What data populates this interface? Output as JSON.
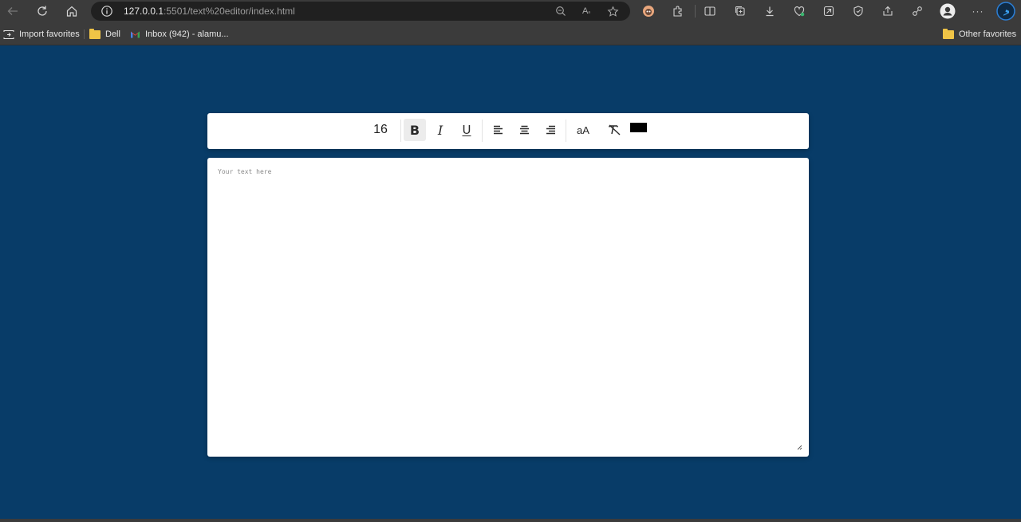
{
  "browser": {
    "url_host": "127.0.0.1",
    "url_rest": ":5501/text%20editor/index.html",
    "favorites": [
      {
        "label": "Import favorites"
      },
      {
        "label": "Dell"
      },
      {
        "label": "Inbox (942) - alamu..."
      }
    ],
    "other_favorites": "Other favorites",
    "more_label": "···"
  },
  "editor": {
    "font_size": "16",
    "bold_label": "B",
    "italic_label": "I",
    "underline_label": "U",
    "case_label": "aA",
    "text_color": "#000000",
    "placeholder": "Your text here",
    "active_tool": "bold"
  },
  "colors": {
    "page_background": "#083c68",
    "card_background": "#ffffff",
    "chrome_background": "#3b3b3b"
  }
}
